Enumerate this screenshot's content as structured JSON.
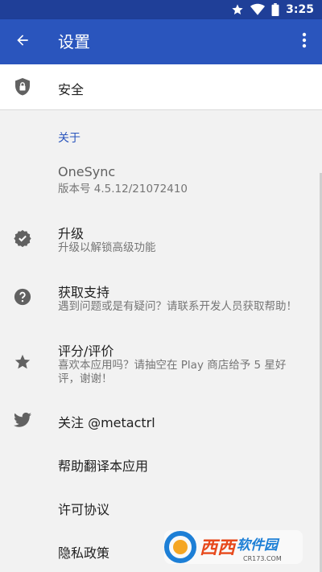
{
  "status_bar": {
    "time": "3:25",
    "icons": [
      "star-icon",
      "wifi-icon",
      "battery-icon"
    ]
  },
  "app_bar": {
    "title": "设置",
    "back_icon": "arrow-left-icon",
    "menu_icon": "more-vert-icon"
  },
  "colors": {
    "status_bar": "#1f3f98",
    "app_bar": "#2a55bd",
    "accent": "#2a55bd",
    "background": "#f2f2f2",
    "icon": "#616161"
  },
  "settings": {
    "security": {
      "title": "安全",
      "icon": "lock-shield-icon"
    },
    "about_category": "关于",
    "app_info": {
      "title": "OneSync",
      "summary": "版本号 4.5.12/21072410"
    },
    "upgrade": {
      "title": "升级",
      "summary": "升级以解锁高级功能",
      "icon": "verified-badge-icon"
    },
    "support": {
      "title": "获取支持",
      "summary": "遇到问题或是有疑问？请联系开发人员获取帮助！",
      "icon": "help-icon"
    },
    "rate": {
      "title": "评分/评价",
      "summary_line1": "喜欢本应用吗？请抽空在 Play 商店给予 5 星好",
      "summary_line2": "评，谢谢！",
      "icon": "star-icon"
    },
    "follow": {
      "title": "关注 @metactrl",
      "icon": "twitter-icon"
    },
    "translate": {
      "title": "帮助翻译本应用"
    },
    "license": {
      "title": "许可协议"
    },
    "privacy": {
      "title": "隐私政策"
    }
  },
  "watermark": {
    "brand": "西西软件园",
    "url": "CR173.COM"
  }
}
